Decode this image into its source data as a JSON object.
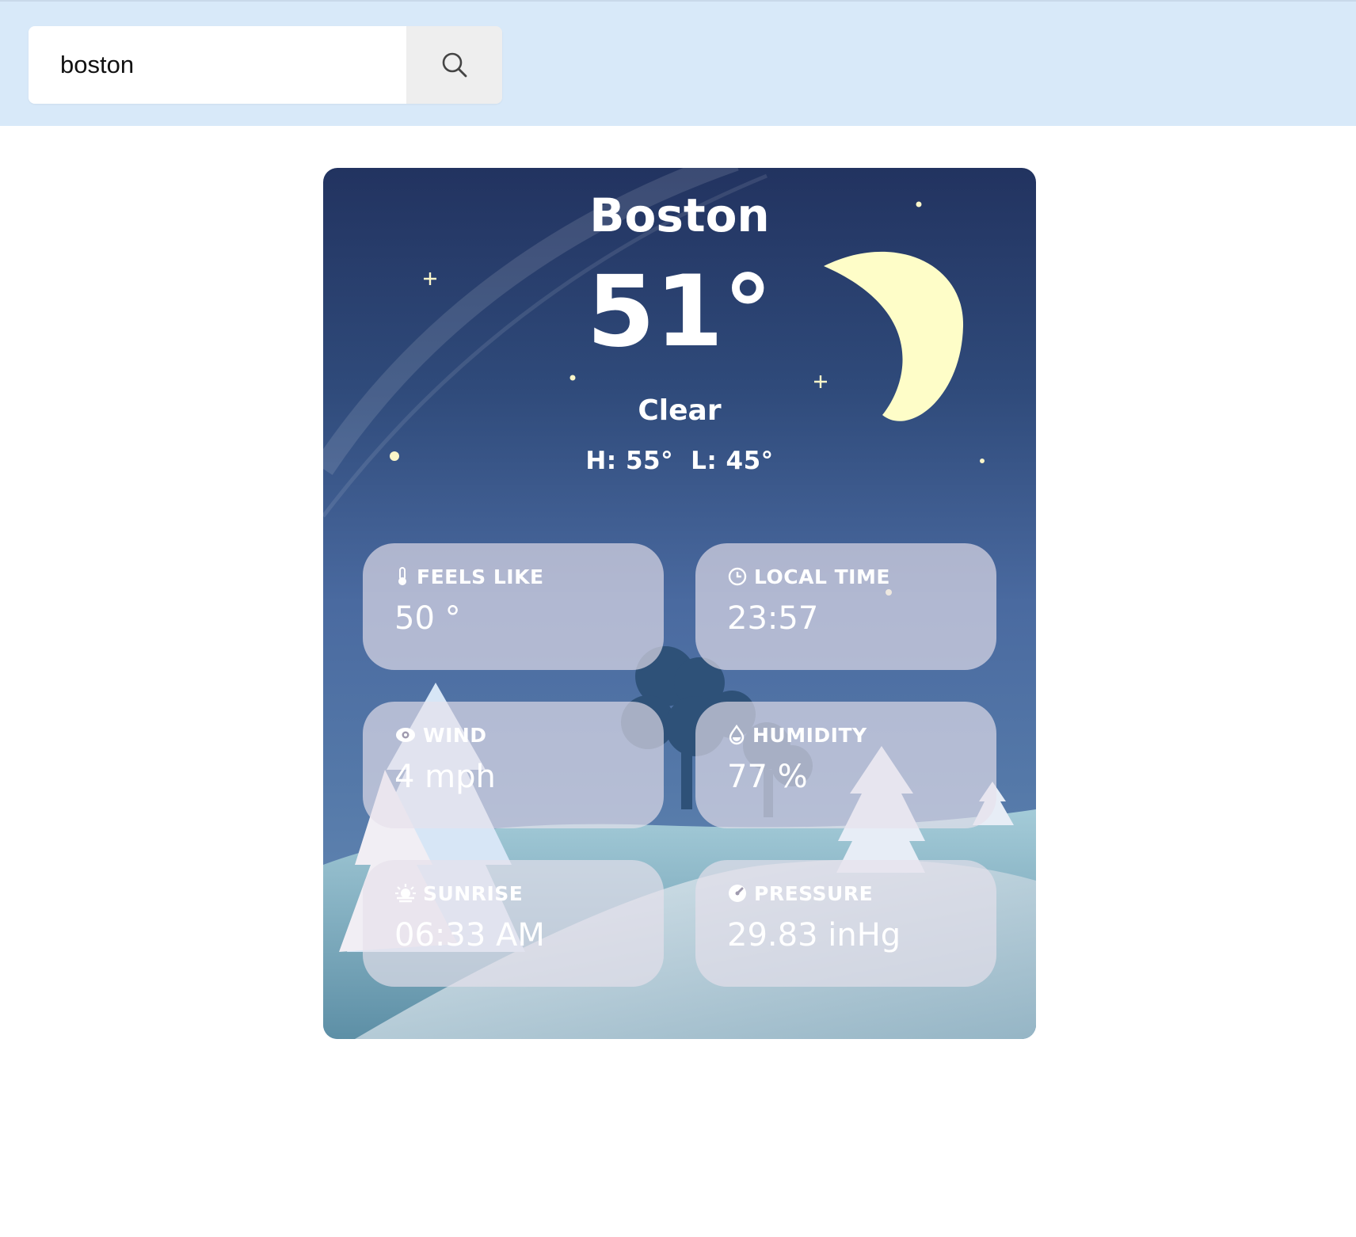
{
  "search": {
    "value": "boston",
    "button_icon": "search-icon"
  },
  "weather": {
    "city": "Boston",
    "temperature": "51°",
    "condition": "Clear",
    "high": "H: 55°",
    "low": "L: 45°",
    "scene": "night-moon-stars-snowy-hills"
  },
  "details": {
    "feels_like": {
      "label": "FEELS LIKE",
      "value": "50 °",
      "icon": "thermometer-icon"
    },
    "local_time": {
      "label": "LOCAL TIME",
      "value": "23:57",
      "icon": "clock-icon"
    },
    "wind": {
      "label": "WIND",
      "value": "4 mph",
      "icon": "eye-icon"
    },
    "humidity": {
      "label": "HUMIDITY",
      "value": "77 %",
      "icon": "droplet-icon"
    },
    "sunrise": {
      "label": "SUNRISE",
      "value": "06:33 AM",
      "icon": "sunrise-icon"
    },
    "pressure": {
      "label": "PRESSURE",
      "value": "29.83 inHg",
      "icon": "gauge-icon"
    }
  },
  "colors": {
    "topbar": "#d8e9f9",
    "moon": "#fefdc8",
    "sky_top": "#223360",
    "sky_bottom": "#6a8fb8"
  }
}
